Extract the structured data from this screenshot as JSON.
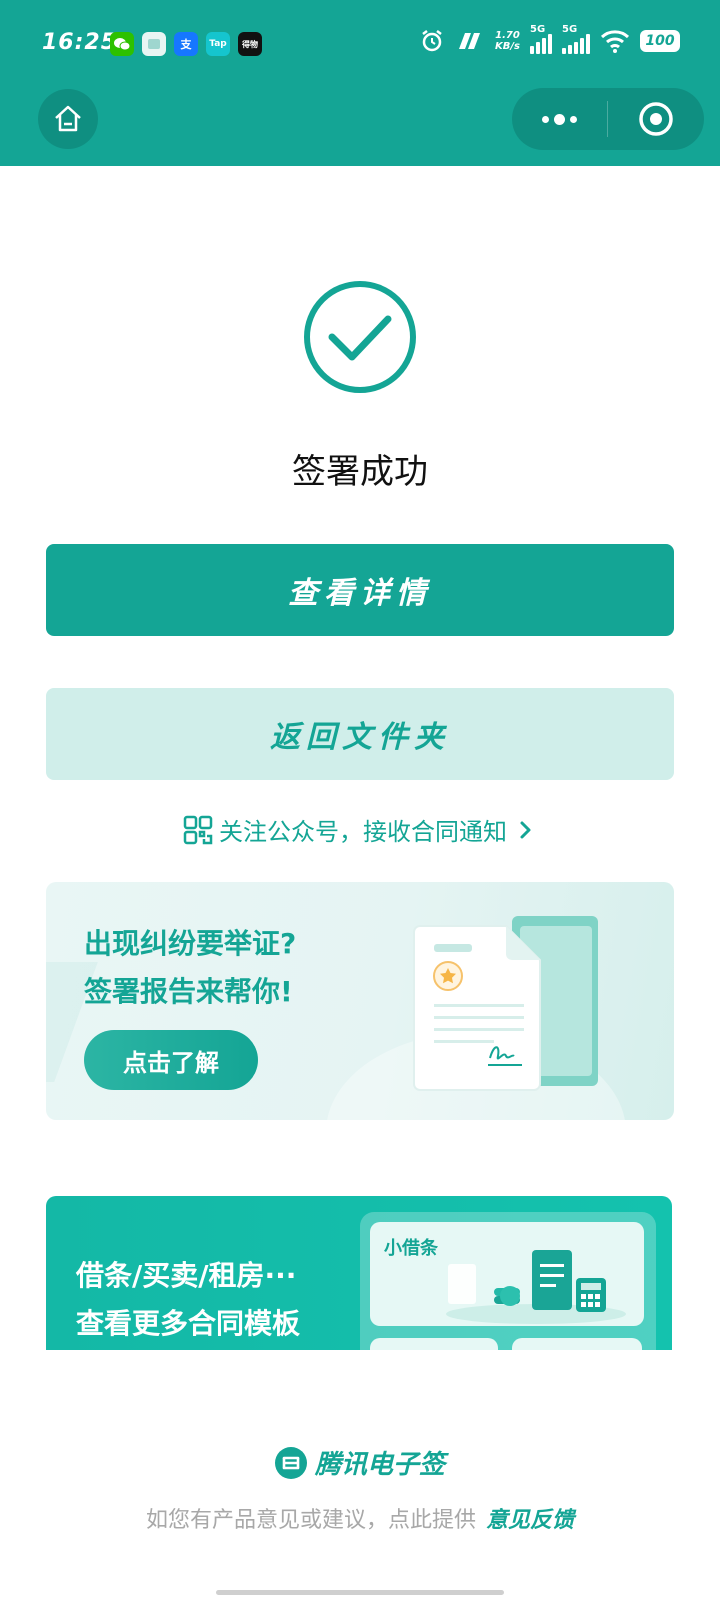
{
  "status_bar": {
    "time": "16:25",
    "app_icons": [
      {
        "name": "wechat-icon",
        "text": "",
        "color": "#2dc100"
      },
      {
        "name": "message-icon",
        "text": "",
        "color": "#e8f5f3"
      },
      {
        "name": "alipay-icon",
        "text": "支",
        "color": "#1677ff"
      },
      {
        "name": "taptap-icon",
        "text": "Tap",
        "color": "#15c5ce"
      },
      {
        "name": "app-icon",
        "text": "得物",
        "color": "#111111"
      }
    ],
    "net_speed_value": "1.70",
    "net_speed_unit": "KB/s",
    "signal1_label": "5G",
    "signal2_label": "5G",
    "battery": "100"
  },
  "success": {
    "title": "签署成功"
  },
  "actions": {
    "view_details": "查看详情",
    "back_to_folder": "返回文件夹"
  },
  "follow": {
    "label": "关注公众号，接收合同通知"
  },
  "promo": {
    "line1": "出现纠纷要举证?",
    "line2": "签署报告来帮你!",
    "button": "点击了解"
  },
  "templates": {
    "line1": "借条/买卖/租房···",
    "line2": "查看更多合同模板",
    "item_label": "小借条"
  },
  "footer": {
    "brand": "腾讯电子签",
    "feedback_text": "如您有产品意见或建议，点此提供",
    "feedback_link": "意见反馈"
  },
  "colors": {
    "brand": "#14a595",
    "brand_dark": "#0f8f81",
    "secondary_bg": "#d0eeea",
    "template_bg": "#14b8a6"
  }
}
